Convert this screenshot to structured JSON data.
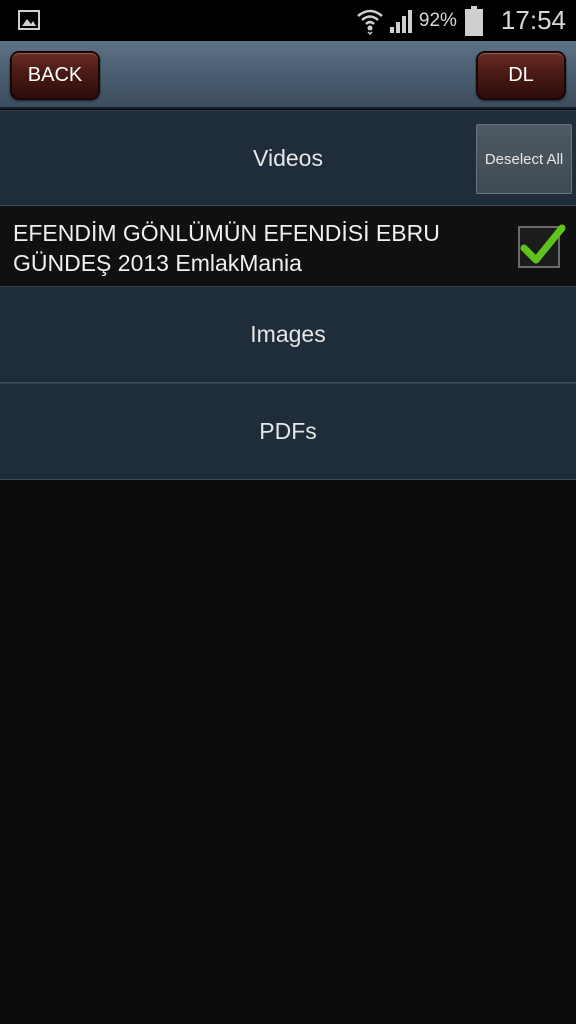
{
  "status_bar": {
    "battery_percent": "92%",
    "time": "17:54",
    "icons": [
      "image-icon",
      "wifi-icon",
      "signal-icon",
      "battery-icon"
    ]
  },
  "toolbar": {
    "back_label": "BACK",
    "dl_label": "DL"
  },
  "sections": {
    "videos": {
      "label": "Videos",
      "deselect_label": "Deselect All",
      "items": [
        {
          "title": "EFENDİM GÖNLÜMÜN EFENDİSİ EBRU GÜNDEŞ 2013 EmlakMania",
          "checked": true
        }
      ]
    },
    "images": {
      "label": "Images"
    },
    "pdfs": {
      "label": "PDFs"
    }
  },
  "colors": {
    "accent_check": "#5fc31e",
    "toolbar_button": "#4a1a16",
    "section_bg": "#1f2c3a"
  }
}
